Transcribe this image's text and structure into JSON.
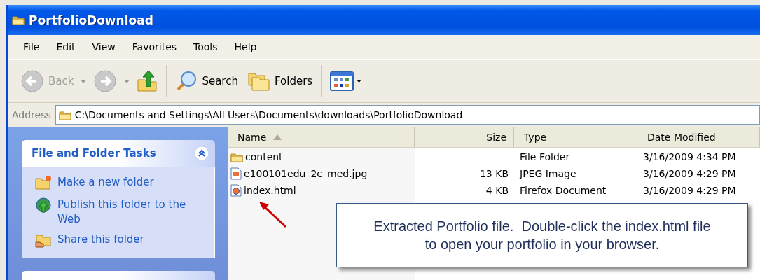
{
  "window": {
    "title": "PortfolioDownload"
  },
  "menu": [
    "File",
    "Edit",
    "View",
    "Favorites",
    "Tools",
    "Help"
  ],
  "toolbar": [
    {
      "kind": "back",
      "label": "Back",
      "disabled": true
    },
    {
      "kind": "forward",
      "disabled": true
    },
    {
      "kind": "up"
    },
    {
      "kind": "search",
      "label": "Search"
    },
    {
      "kind": "folders",
      "label": "Folders"
    },
    {
      "kind": "views"
    }
  ],
  "address": {
    "label": "Address",
    "value": "C:\\Documents and Settings\\All Users\\Documents\\downloads\\PortfolioDownload"
  },
  "task_panel": {
    "title": "File and Folder Tasks",
    "expanded": true,
    "items": [
      {
        "kind": "new-folder",
        "label": "Make a new folder"
      },
      {
        "kind": "publish",
        "label": "Publish this folder to the Web"
      },
      {
        "kind": "share",
        "label": "Share this folder"
      }
    ]
  },
  "table": {
    "columns": [
      {
        "label": "Name",
        "sorted": true
      },
      {
        "label": "Size",
        "sorted": false
      },
      {
        "label": "Type",
        "sorted": false
      },
      {
        "label": "Date Modified",
        "sorted": false
      }
    ],
    "rows": [
      {
        "kind": "folder",
        "name": "content",
        "size": "",
        "type": "File Folder",
        "date": "3/16/2009 4:34 PM"
      },
      {
        "kind": "image",
        "name": "e100101edu_2c_med.jpg",
        "size": "13 KB",
        "type": "JPEG Image",
        "date": "3/16/2009 4:29 PM"
      },
      {
        "kind": "html",
        "name": "index.html",
        "size": "4 KB",
        "type": "Firefox Document",
        "date": "3/16/2009 4:29 PM"
      }
    ]
  },
  "callout": {
    "lines": [
      "Extracted Portfolio file.  Double-click the index.html file",
      "to open your portfolio in your browser."
    ]
  }
}
